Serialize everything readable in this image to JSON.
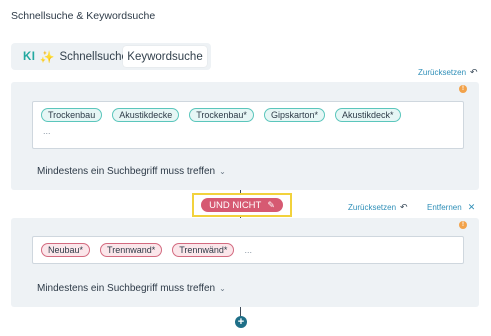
{
  "title": "Schnellsuche & Keywordsuche",
  "tabs": {
    "ki_badge": "KI",
    "ki_spark": "✨",
    "ki_label": "Schnellsuche",
    "keyword_label": "Keywordsuche"
  },
  "block1": {
    "reset_label": "Zurücksetzen",
    "reset_icon": "↶",
    "info_icon": "!",
    "chips": [
      "Trockenbau",
      "Akustikdecke",
      "Trockenbau*",
      "Gipskarton*",
      "Akustikdeck*"
    ],
    "more": "...",
    "match_label": "Mindestens ein Suchbegriff muss treffen",
    "match_chevron": "⌄"
  },
  "operator": {
    "label": "UND NICHT",
    "edit_icon": "✎",
    "reset_label": "Zurücksetzen",
    "reset_icon": "↶",
    "remove_label": "Entfernen",
    "remove_icon": "✕"
  },
  "block2": {
    "info_icon": "!",
    "chips": [
      "Neubau*",
      "Trennwand*",
      "Trennwänd*"
    ],
    "more": "...",
    "match_label": "Mindestens ein Suchbegriff muss treffen",
    "match_chevron": "⌄"
  },
  "add_icon": "+",
  "colors": {
    "accent_teal": "#22a9a0",
    "link_blue": "#2f8fb8",
    "negative_pink": "#d65a72",
    "highlight_yellow": "#f2d23c",
    "info_orange": "#f2a24a"
  }
}
